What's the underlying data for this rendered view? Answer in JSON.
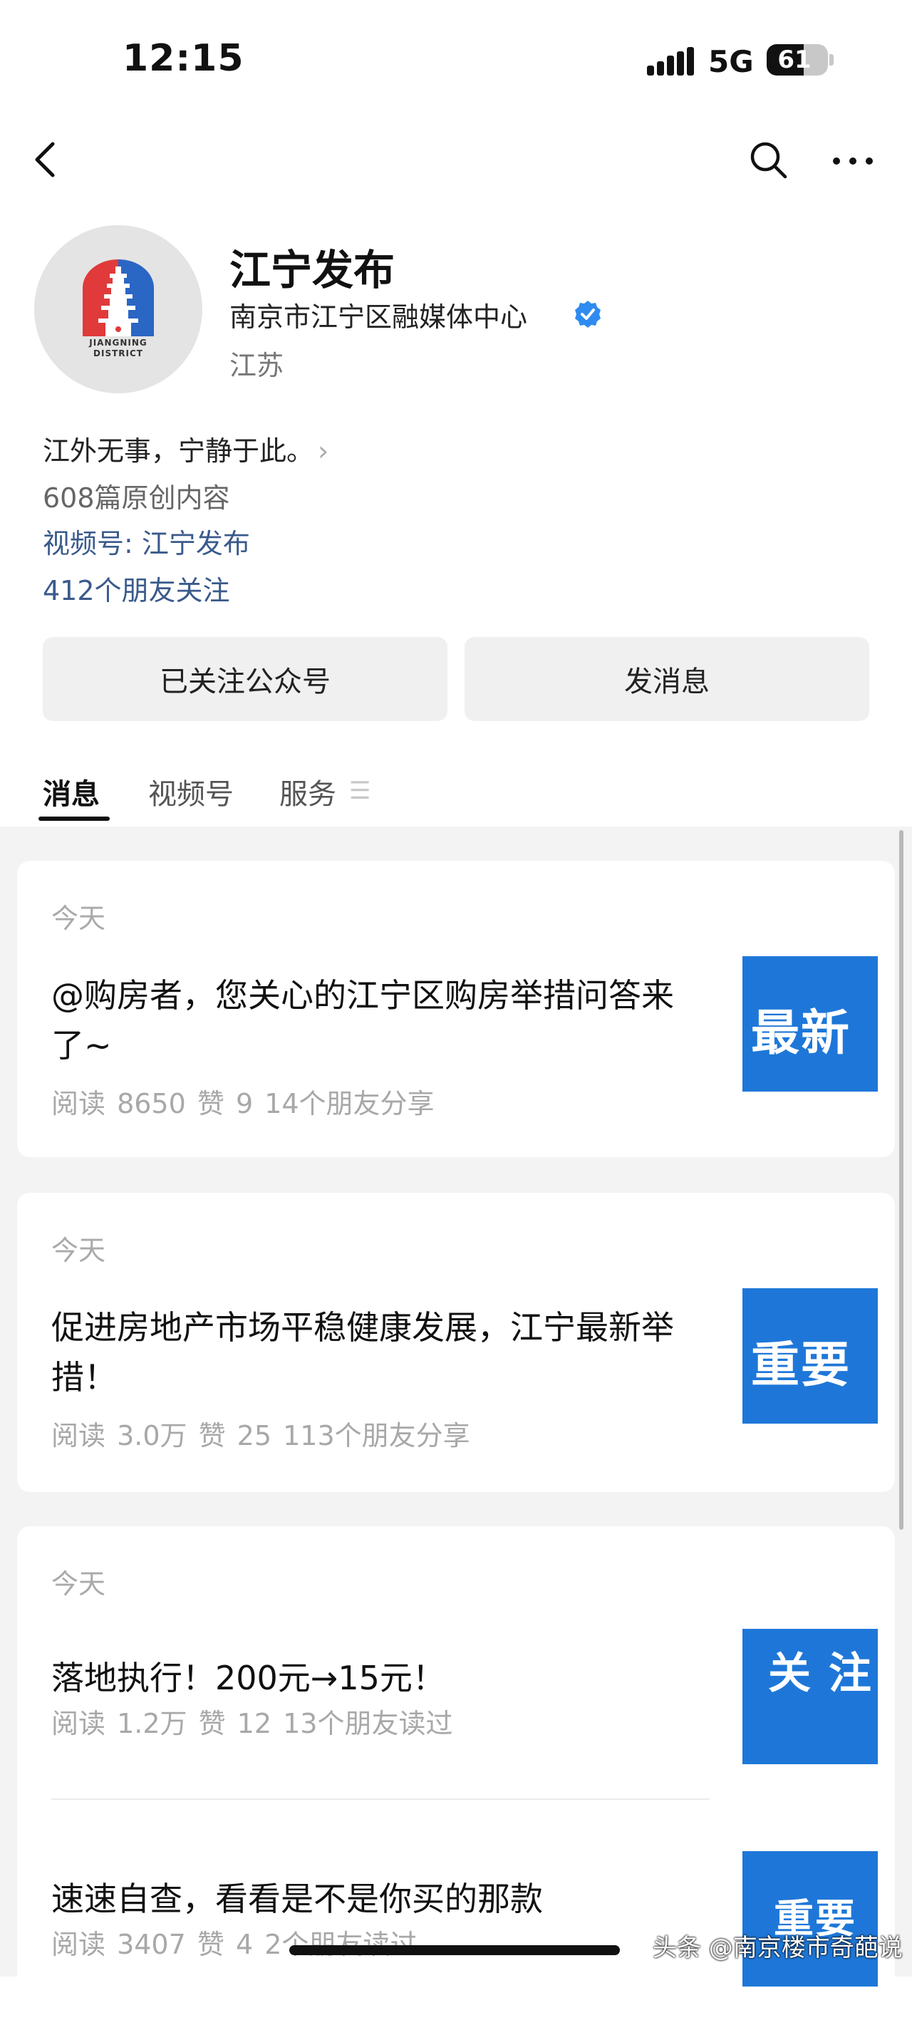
{
  "status_bar": {
    "time": "12:15",
    "network": "5G",
    "battery": "61",
    "battery_level": 0.61
  },
  "nav": {
    "back_icon": "chevron-left-icon",
    "search_icon": "search-icon",
    "more_icon": "ellipsis-icon"
  },
  "profile": {
    "name": "江宁发布",
    "organization": "南京市江宁区融媒体中心",
    "region": "江苏",
    "logo_text_line1": "JIANGNING",
    "logo_text_line2": "DISTRICT",
    "intro": "江外无事，宁静于此。",
    "original_count": "608篇原创内容",
    "channel": "视频号: 江宁发布",
    "friends_following": "412个朋友关注"
  },
  "actions": {
    "followed_label": "已关注公众号",
    "message_label": "发消息"
  },
  "tabs": [
    {
      "label": "消息"
    },
    {
      "label": "视频号"
    },
    {
      "label": "服务"
    }
  ],
  "feed": [
    {
      "date": "今天",
      "articles": [
        {
          "title": "@购房者，您关心的江宁区购房举措问答来了~",
          "stats": "阅读 8650  赞 9  14个朋友分享",
          "thumb_text": "最新"
        }
      ]
    },
    {
      "date": "今天",
      "articles": [
        {
          "title": "促进房地产市场平稳健康发展，江宁最新举措！",
          "stats": "阅读 3.0万  赞 25  113个朋友分享",
          "thumb_text": "重要"
        }
      ]
    },
    {
      "date": "今天",
      "articles": [
        {
          "title": "落地执行！200元→15元！",
          "stats": "阅读 1.2万  赞 12  13个朋友读过",
          "thumb_text": "关 注"
        },
        {
          "title": "速速自查，看看是不是你买的那款",
          "stats": "阅读 3407  赞 4  2个朋友读过",
          "thumb_text": "重要"
        }
      ]
    }
  ],
  "watermark": "头条 @南京楼市奇葩说",
  "colors": {
    "link": "#3a5a8c",
    "verified": "#2f8bf0",
    "thumb_blue": "#1e77d8",
    "logo_red": "#e03a3a",
    "logo_blue": "#2a66c4"
  }
}
